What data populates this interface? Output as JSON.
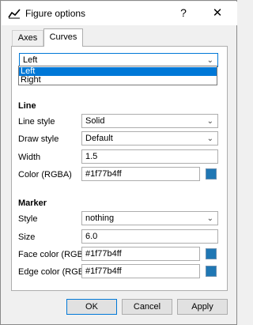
{
  "window": {
    "title": "Figure options",
    "help_label": "?",
    "close_label": "✕"
  },
  "tabs": [
    {
      "label": "Axes"
    },
    {
      "label": "Curves"
    }
  ],
  "curve_select": {
    "value": "Left",
    "options": [
      "Left",
      "Right"
    ]
  },
  "line": {
    "heading": "Line",
    "style_label": "Line style",
    "style_value": "Solid",
    "draw_label": "Draw style",
    "draw_value": "Default",
    "width_label": "Width",
    "width_value": "1.5",
    "color_label": "Color (RGBA)",
    "color_value": "#1f77b4ff"
  },
  "marker": {
    "heading": "Marker",
    "style_label": "Style",
    "style_value": "nothing",
    "size_label": "Size",
    "size_value": "6.0",
    "face_label": "Face color (RGBA)",
    "face_value": "#1f77b4ff",
    "edge_label": "Edge color (RGBA)",
    "edge_value": "#1f77b4ff"
  },
  "buttons": {
    "ok": "OK",
    "cancel": "Cancel",
    "apply": "Apply"
  },
  "colors": {
    "swatch": "#1f77b4",
    "accent": "#0078d7"
  }
}
